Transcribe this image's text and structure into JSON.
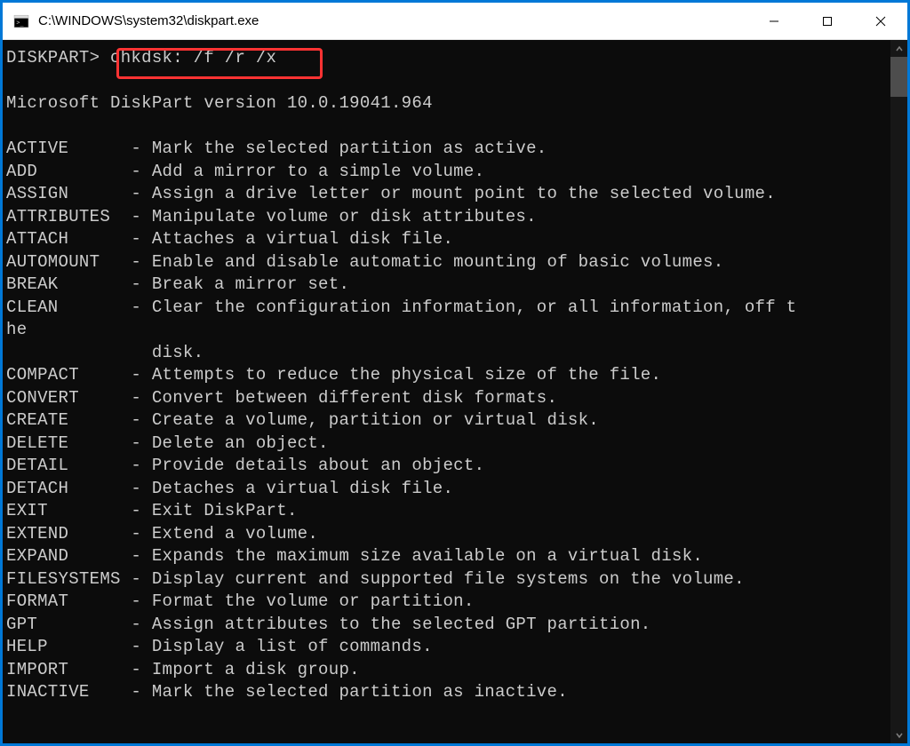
{
  "titlebar": {
    "title": "C:\\WINDOWS\\system32\\diskpart.exe"
  },
  "terminal": {
    "prompt": "DISKPART>",
    "command": "chkdsk: /f /r /x",
    "version_line": "Microsoft DiskPart version 10.0.19041.964",
    "commands": [
      {
        "name": "ACTIVE",
        "desc": "- Mark the selected partition as active."
      },
      {
        "name": "ADD",
        "desc": "- Add a mirror to a simple volume."
      },
      {
        "name": "ASSIGN",
        "desc": "- Assign a drive letter or mount point to the selected volume."
      },
      {
        "name": "ATTRIBUTES",
        "desc": "- Manipulate volume or disk attributes."
      },
      {
        "name": "ATTACH",
        "desc": "- Attaches a virtual disk file."
      },
      {
        "name": "AUTOMOUNT",
        "desc": "- Enable and disable automatic mounting of basic volumes."
      },
      {
        "name": "BREAK",
        "desc": "- Break a mirror set."
      },
      {
        "name": "CLEAN",
        "desc": "- Clear the configuration information, or all information, off t"
      },
      {
        "name": "he",
        "desc": ""
      },
      {
        "name": "",
        "desc": "  disk."
      },
      {
        "name": "COMPACT",
        "desc": "- Attempts to reduce the physical size of the file."
      },
      {
        "name": "CONVERT",
        "desc": "- Convert between different disk formats."
      },
      {
        "name": "CREATE",
        "desc": "- Create a volume, partition or virtual disk."
      },
      {
        "name": "DELETE",
        "desc": "- Delete an object."
      },
      {
        "name": "DETAIL",
        "desc": "- Provide details about an object."
      },
      {
        "name": "DETACH",
        "desc": "- Detaches a virtual disk file."
      },
      {
        "name": "EXIT",
        "desc": "- Exit DiskPart."
      },
      {
        "name": "EXTEND",
        "desc": "- Extend a volume."
      },
      {
        "name": "EXPAND",
        "desc": "- Expands the maximum size available on a virtual disk."
      },
      {
        "name": "FILESYSTEMS",
        "desc": "- Display current and supported file systems on the volume."
      },
      {
        "name": "FORMAT",
        "desc": "- Format the volume or partition."
      },
      {
        "name": "GPT",
        "desc": "- Assign attributes to the selected GPT partition."
      },
      {
        "name": "HELP",
        "desc": "- Display a list of commands."
      },
      {
        "name": "IMPORT",
        "desc": "- Import a disk group."
      },
      {
        "name": "INACTIVE",
        "desc": "- Mark the selected partition as inactive."
      }
    ]
  }
}
